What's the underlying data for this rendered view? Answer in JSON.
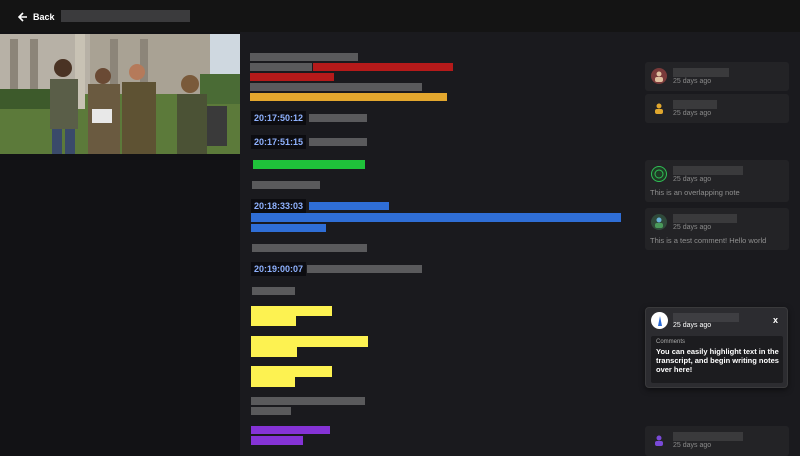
{
  "header": {
    "back_label": "Back"
  },
  "transcript": {
    "timestamps": [
      "20:17:50:12",
      "20:17:51:15",
      "20:18:33:03",
      "20:19:00:07"
    ]
  },
  "comments": [
    {
      "ago": "25 days ago",
      "text": ""
    },
    {
      "ago": "25 days ago",
      "text": ""
    },
    {
      "ago": "25 days ago",
      "text": "This is an overlapping note"
    },
    {
      "ago": "25 days ago",
      "text": "This is a test comment! Hello world"
    },
    {
      "ago": "25 days ago",
      "text": ""
    }
  ],
  "popup": {
    "ago": "25 days ago",
    "close_label": "x",
    "section_label": "Comments",
    "text": "You can easily highlight text in the transcript, and begin writing notes over here!"
  },
  "colors": {
    "highlight_red": "#b51a1a",
    "highlight_orange": "#e3a72e",
    "highlight_green": "#1fc23a",
    "highlight_blue": "#2f6ed6",
    "highlight_yellow": "#fdf251",
    "highlight_purple": "#8533d6",
    "timestamp_text": "#8fb2ff"
  }
}
